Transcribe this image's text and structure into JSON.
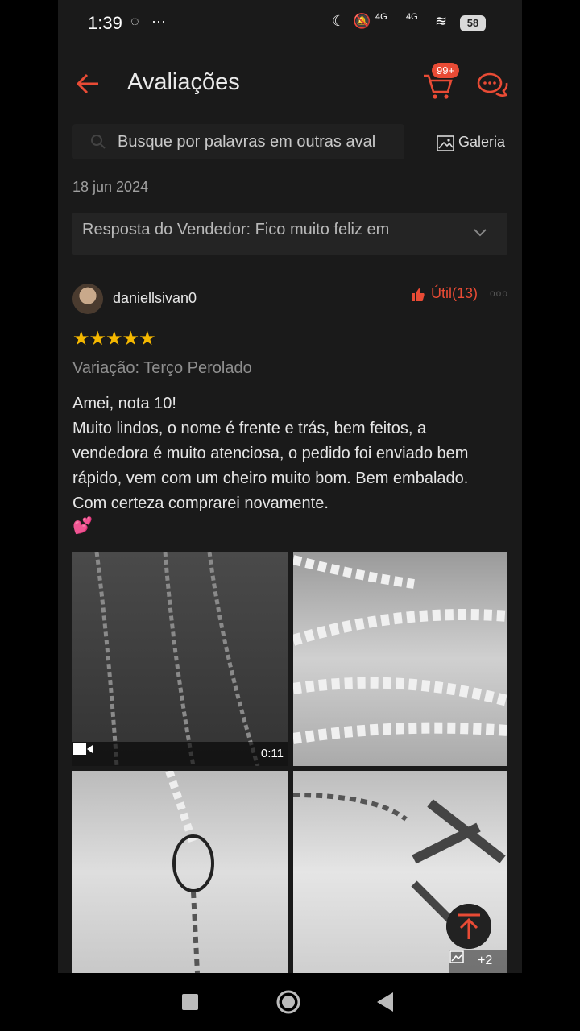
{
  "status_bar": {
    "time": "1:39",
    "more": "···",
    "battery": "58",
    "net1": "4G",
    "net2": "4G"
  },
  "header": {
    "title": "Avaliações",
    "cart_badge": "99+"
  },
  "search": {
    "placeholder": "Busque por palavras em outras aval",
    "gallery_label": "Galeria"
  },
  "date": "18 jun 2024",
  "seller_reply": {
    "text": "Resposta do Vendedor: Fico muito feliz em"
  },
  "review": {
    "username": "daniellsivan0",
    "useful_label": "Útil(13)",
    "stars": 5,
    "variation": "Variação: Terço Perolado",
    "text_lines": [
      "Amei, nota 10!",
      "Muito lindos, o nome é frente e trás, bem feitos, a vendedora é muito atenciosa, o pedido foi enviado bem rápido, vem com um cheiro muito bom. Bem embalado. Com certeza comprarei novamente."
    ],
    "emoji": "💕",
    "video_duration": "0:11",
    "more_photos": "+2"
  },
  "colors": {
    "accent": "#e94b35",
    "star": "#f5b800",
    "background": "#1a1a1a"
  },
  "icons": [
    "back-arrow-icon",
    "cart-icon",
    "chat-icon",
    "search-icon",
    "gallery-icon",
    "chevron-down-icon",
    "thumbs-up-icon",
    "video-icon",
    "image-icon",
    "scroll-to-top-icon"
  ]
}
